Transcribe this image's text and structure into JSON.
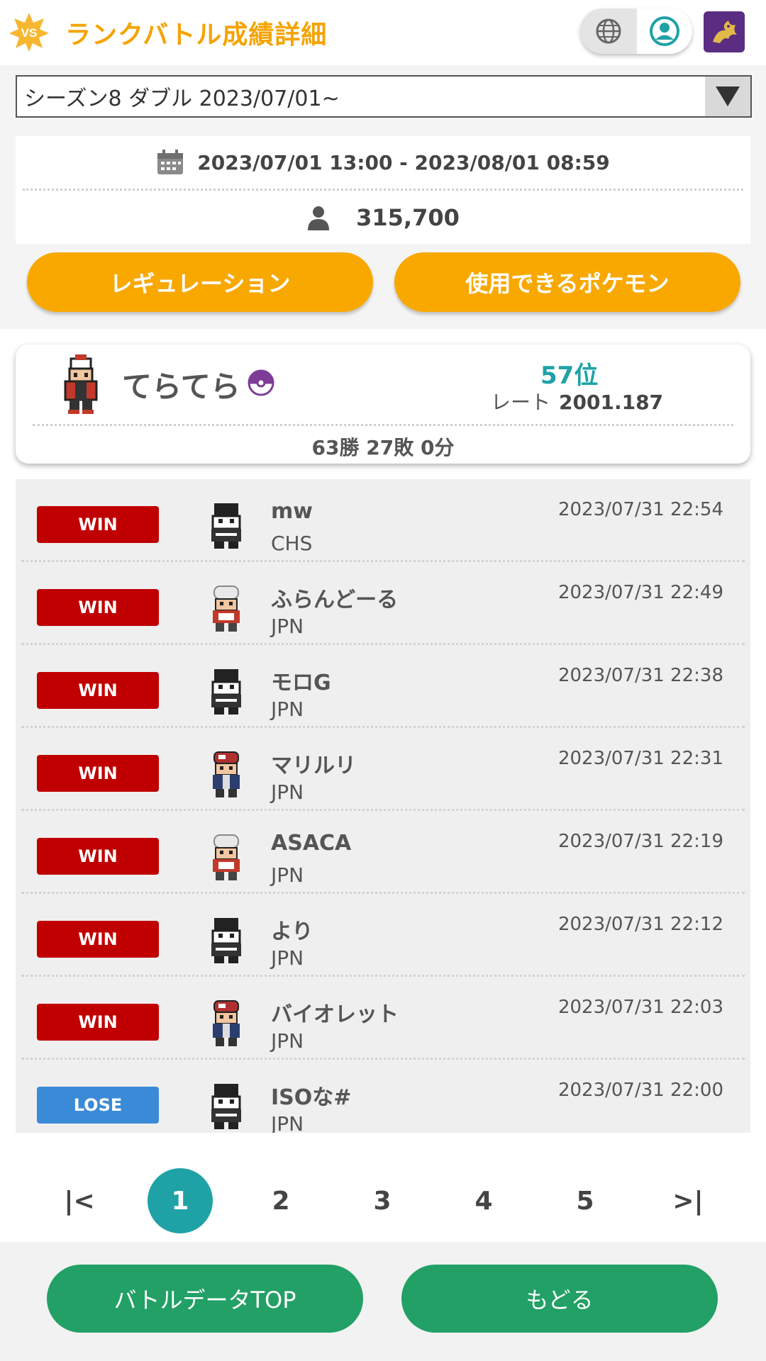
{
  "header": {
    "badge_text": "VS",
    "title": "ランクバトル成績詳細",
    "icons": [
      "globe-icon",
      "user-circle-icon",
      "dragon-avatar"
    ]
  },
  "season": {
    "selected": "シーズン8 ダブル 2023/07/01~"
  },
  "info": {
    "period": "2023/07/01 13:00 - 2023/08/01 08:59",
    "players": "315,700"
  },
  "buttons": {
    "regulation": "レギュレーション",
    "usable_pokemon": "使用できるポケモン"
  },
  "profile": {
    "name": "てらてら",
    "rank": "57位",
    "rate_label": "レート",
    "rate_value": "2001.187",
    "record": "63勝 27敗 0分"
  },
  "battles": [
    {
      "result": "WIN",
      "name": "mw",
      "region": "CHS",
      "time": "2023/07/31 22:54",
      "sprite": "dark"
    },
    {
      "result": "WIN",
      "name": "ふらんどーる",
      "region": "JPN",
      "time": "2023/07/31 22:49",
      "sprite": "white-hat"
    },
    {
      "result": "WIN",
      "name": "モロG",
      "region": "JPN",
      "time": "2023/07/31 22:38",
      "sprite": "dark"
    },
    {
      "result": "WIN",
      "name": "マリルリ",
      "region": "JPN",
      "time": "2023/07/31 22:31",
      "sprite": "red-cap"
    },
    {
      "result": "WIN",
      "name": "ASACA",
      "region": "JPN",
      "time": "2023/07/31 22:19",
      "sprite": "white-hat"
    },
    {
      "result": "WIN",
      "name": "より",
      "region": "JPN",
      "time": "2023/07/31 22:12",
      "sprite": "dark"
    },
    {
      "result": "WIN",
      "name": "バイオレット",
      "region": "JPN",
      "time": "2023/07/31 22:03",
      "sprite": "red-cap"
    },
    {
      "result": "LOSE",
      "name": "ISOな#",
      "region": "JPN",
      "time": "2023/07/31 22:00",
      "sprite": "dark"
    }
  ],
  "pagination": {
    "first": "|<",
    "pages": [
      "1",
      "2",
      "3",
      "4",
      "5"
    ],
    "current": "1",
    "last": ">|"
  },
  "footer": {
    "top_button": "バトルデータTOP",
    "back_button": "もどる"
  },
  "colors": {
    "accent": "#f9a800",
    "teal": "#1fa2a6",
    "win": "#c00000",
    "lose": "#3a8ad8",
    "green": "#22a066"
  }
}
